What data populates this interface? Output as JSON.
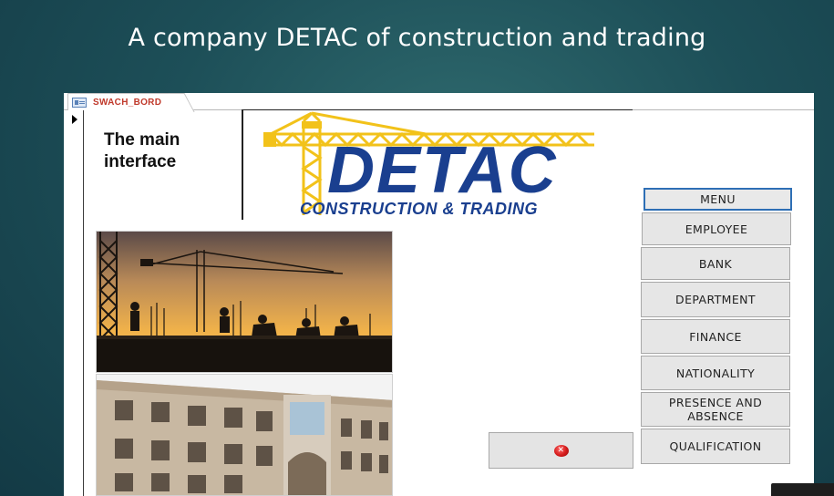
{
  "slide": {
    "title": "A company DETAC of construction and trading"
  },
  "form": {
    "tab_label": "SWACH_BORD",
    "heading": "The main interface",
    "logo": {
      "brand": "DETAC",
      "tagline": "CONSTRUCTION & TRADING"
    },
    "buttons": {
      "menu": "MENU",
      "employee": "EMPLOYEE",
      "bank": "BANK",
      "department": "DEPARTMENT",
      "finance": "FINANCE",
      "nationality": "NATIONALITY",
      "presence_absence": "PRESENCE AND ABSENCE",
      "qualification": "QUALIFICATION",
      "exit_icon": "close-circle-icon"
    }
  },
  "colors": {
    "background": "#1d4f58",
    "logo_blue": "#1a3f8f",
    "logo_yellow": "#f2c21a",
    "tab_label": "#c0392b",
    "menu_border": "#2e6fb5"
  }
}
